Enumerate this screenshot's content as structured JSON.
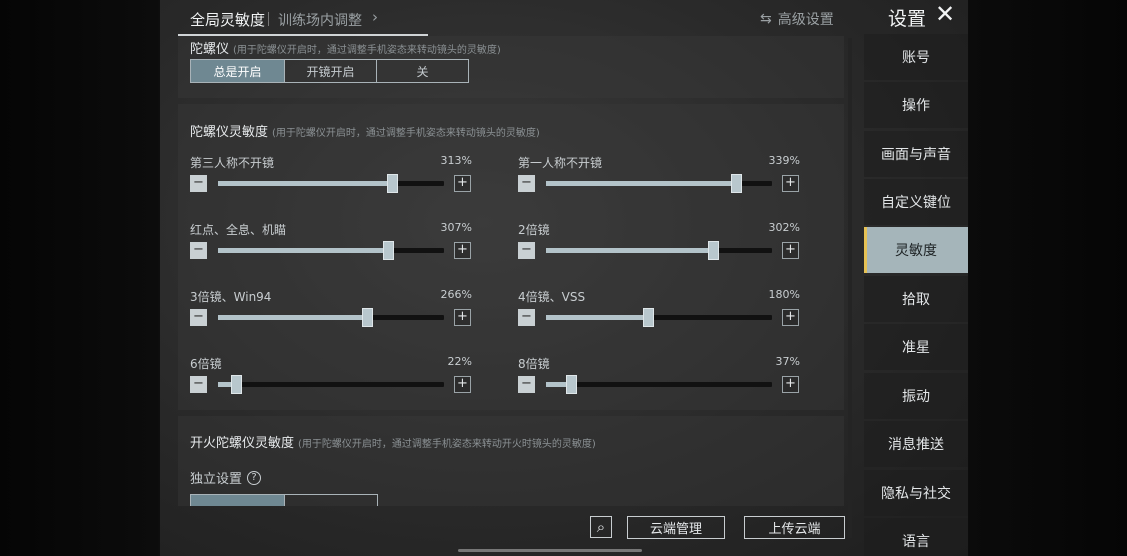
{
  "header": {
    "tab_active": "全局灵敏度",
    "tab_secondary": "训练场内调整",
    "chevron": "›",
    "advanced_icon": "⇆",
    "advanced_label": "高级设置",
    "settings_title": "设置",
    "close_glyph": "✕"
  },
  "gyro": {
    "title": "陀螺仪",
    "hint": "(用于陀螺仪开启时，通过调整手机姿态来转动镜头的灵敏度)",
    "options": [
      "总是开启",
      "开镜开启",
      "关"
    ],
    "selected": "总是开启"
  },
  "gyro_sens": {
    "title": "陀螺仪灵敏度",
    "hint": "(用于陀螺仪开启时，通过调整手机姿态来转动镜头的灵敏度)",
    "minus": "−",
    "plus": "+",
    "rows": [
      {
        "label": "第三人称不开镜",
        "value": "313%",
        "fraction": 0.77
      },
      {
        "label": "第一人称不开镜",
        "value": "339%",
        "fraction": 0.84
      },
      {
        "label": "红点、全息、机瞄",
        "value": "307%",
        "fraction": 0.75
      },
      {
        "label": "2倍镜",
        "value": "302%",
        "fraction": 0.74
      },
      {
        "label": "3倍镜、Win94",
        "value": "266%",
        "fraction": 0.66
      },
      {
        "label": "4倍镜、VSS",
        "value": "180%",
        "fraction": 0.45
      },
      {
        "label": "6倍镜",
        "value": "22%",
        "fraction": 0.08
      },
      {
        "label": "8倍镜",
        "value": "37%",
        "fraction": 0.11
      }
    ]
  },
  "fire_gyro": {
    "title": "开火陀螺仪灵敏度",
    "hint": "(用于陀螺仪开启时，通过调整手机姿态来转动开火时镜头的灵敏度)",
    "independent_label": "独立设置",
    "help_glyph": "?"
  },
  "bottom": {
    "search_glyph": "⌕",
    "cloud_manage": "云端管理",
    "cloud_upload": "上传云端"
  },
  "sidebar": {
    "items": [
      "账号",
      "操作",
      "画面与声音",
      "自定义键位",
      "灵敏度",
      "拾取",
      "准星",
      "振动",
      "消息推送",
      "隐私与社交",
      "语言"
    ],
    "active": "灵敏度"
  }
}
